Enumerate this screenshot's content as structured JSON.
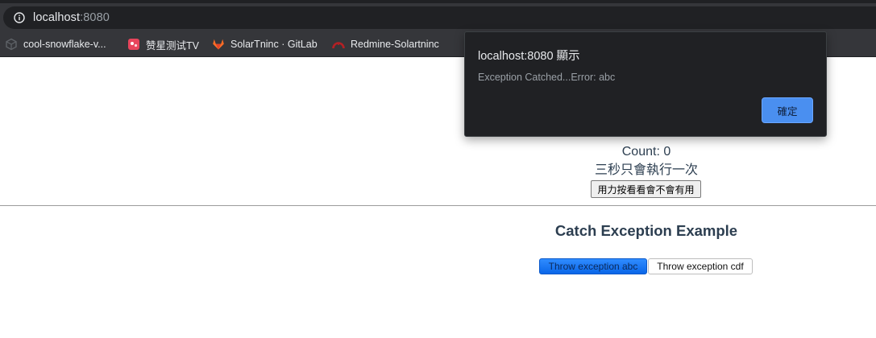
{
  "browser": {
    "url_host": "localhost",
    "url_port": ":8080",
    "bookmarks": [
      {
        "label": "cool-snowflake-v...",
        "icon": "cube-icon"
      },
      {
        "label": "赞星测试TV",
        "icon": "app-icon"
      },
      {
        "label": "SolarTninc · GitLab",
        "icon": "gitlab-icon"
      },
      {
        "label": "Redmine-Solartninc",
        "icon": "redmine-icon"
      }
    ]
  },
  "alert": {
    "title": "localhost:8080 顯示",
    "message": "Exception Catched...Error: abc",
    "ok_label": "確定"
  },
  "counter": {
    "count_text": "Count: 0",
    "limit_text": "三秒只會執行一次",
    "button_label": "用力按看看會不會有用"
  },
  "exception_section": {
    "title": "Catch Exception Example",
    "button_abc": "Throw exception abc",
    "button_cdf": "Throw exception cdf"
  },
  "colors": {
    "chrome_bg": "#35363a",
    "dialog_bg": "#202124",
    "primary_button": "#4a8ff0",
    "text_heading": "#2c3e50"
  }
}
